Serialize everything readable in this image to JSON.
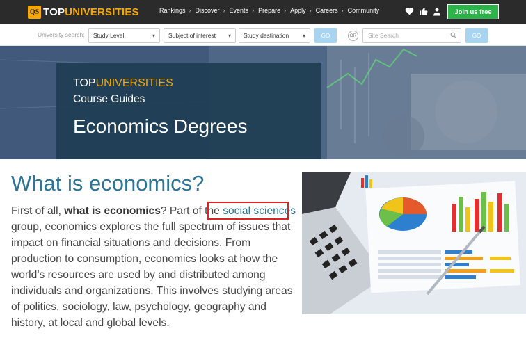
{
  "header": {
    "logo_qs": "QS",
    "logo_top": "TOP",
    "logo_universities": "UNIVERSITIES",
    "nav": [
      "Rankings",
      "Discover",
      "Events",
      "Prepare",
      "Apply",
      "Careers",
      "Community"
    ],
    "join_label": "Join us free"
  },
  "search": {
    "label": "University search:",
    "study_level": "Study Level",
    "subject": "Subject of interest",
    "destination": "Study destination",
    "go_label": "GO",
    "or_label": "OR",
    "site_search_placeholder": "Site Search"
  },
  "hero": {
    "brand_top": "TOP",
    "brand_universities": "UNIVERSITIES",
    "subtitle": "Course Guides",
    "title": "Economics Degrees"
  },
  "content": {
    "heading": "What is economics?",
    "text_intro": "First of all, ",
    "text_bold": "what is economics",
    "text_mid": "? Part of the ",
    "link": "social sciences",
    "text_rest": " group, economics explores the full spectrum of issues that impact on financial situations and decisions. From production to consumption, economics looks at how the world’s resources are used by and distributed among individuals and organizations. This involves studying areas of politics, sociology, law, psychology, geography and history, at local and global levels."
  },
  "colors": {
    "topbar": "#2b2b2b",
    "brand_orange": "#f7a800",
    "join_green": "#2eb34a",
    "heading_blue": "#2c7597",
    "highlight_red": "#dd2222"
  }
}
